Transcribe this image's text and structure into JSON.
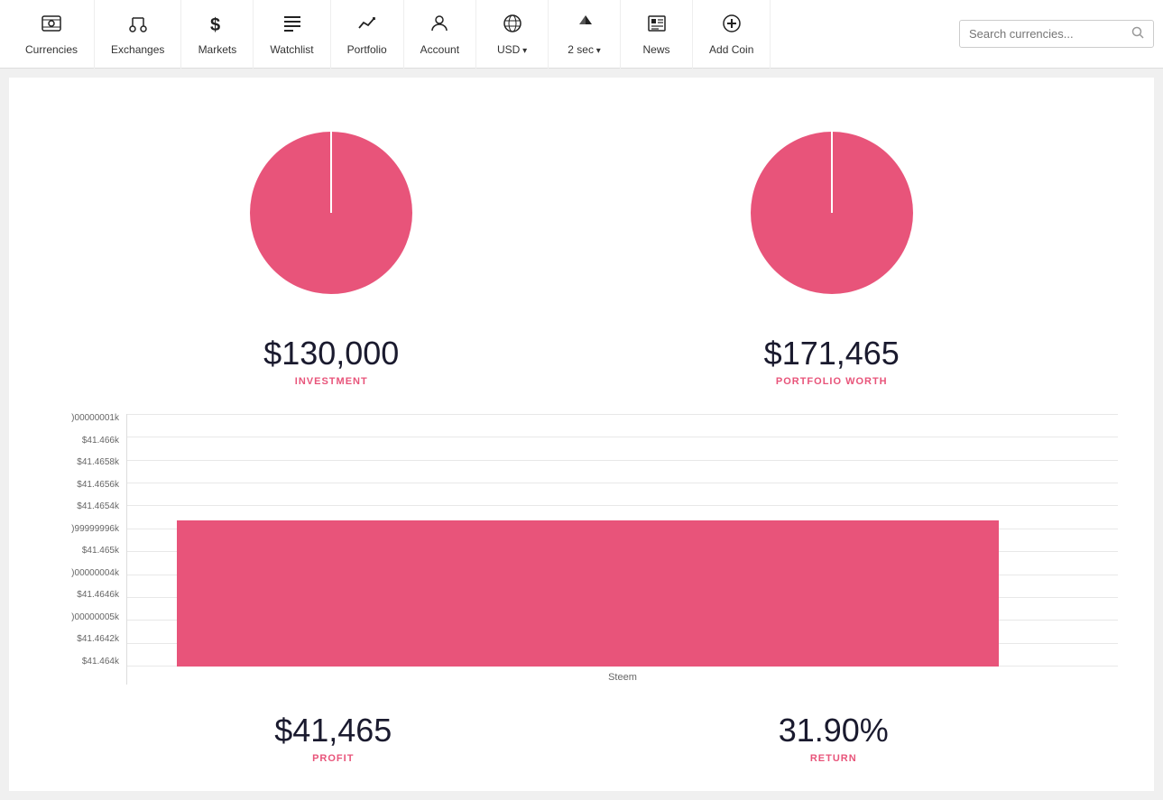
{
  "navbar": {
    "items": [
      {
        "id": "currencies",
        "icon": "💲",
        "label": "Currencies",
        "dropdown": false
      },
      {
        "id": "exchanges",
        "icon": "⚖",
        "label": "Exchanges",
        "dropdown": false
      },
      {
        "id": "markets",
        "icon": "$",
        "label": "Markets",
        "dropdown": false
      },
      {
        "id": "watchlist",
        "icon": "☰",
        "label": "Watchlist",
        "dropdown": false
      },
      {
        "id": "portfolio",
        "icon": "📈",
        "label": "Portfolio",
        "dropdown": false
      },
      {
        "id": "account",
        "icon": "👤",
        "label": "Account",
        "dropdown": false
      },
      {
        "id": "usd",
        "icon": "🌐",
        "label": "USD",
        "dropdown": true
      },
      {
        "id": "2sec",
        "icon": "⚡",
        "label": "2 sec",
        "dropdown": true
      },
      {
        "id": "news",
        "icon": "📰",
        "label": "News",
        "dropdown": false
      },
      {
        "id": "addcoin",
        "icon": "➕",
        "label": "Add Coin",
        "dropdown": false
      }
    ],
    "search_placeholder": "Search currencies..."
  },
  "portfolio": {
    "investment": {
      "value": "$130,000",
      "label": "INVESTMENT",
      "pie_color": "#e8547a",
      "pie_size": 200
    },
    "worth": {
      "value": "$171,465",
      "label": "PORTFOLIO WORTH",
      "pie_color": "#e8547a",
      "pie_size": 180
    }
  },
  "bar_chart": {
    "y_labels": [
      ")00000001k",
      "$41.466k",
      "$41.4658k",
      "$41.4656k",
      "$41.4654k",
      ")99999996k",
      "$41.465k",
      ")00000004k",
      "$41.4646k",
      ")00000005k",
      "$41.4642k",
      "$41.464k"
    ],
    "x_label": "Steem",
    "bar_color": "#e8547a"
  },
  "stats": {
    "profit": {
      "value": "$41,465",
      "label": "PROFIT"
    },
    "return": {
      "value": "31.90%",
      "label": "RETURN"
    }
  }
}
